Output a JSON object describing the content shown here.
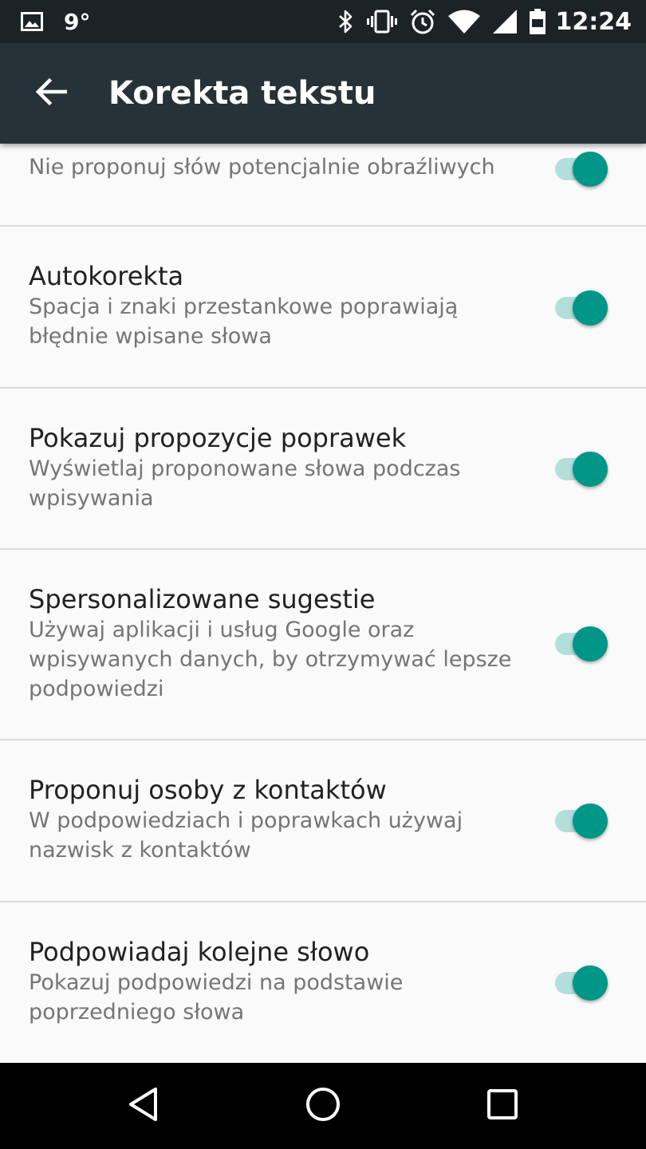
{
  "status_bar": {
    "temperature": "9°",
    "time": "12:24",
    "icons": [
      "image-icon",
      "bluetooth-icon",
      "vibrate-icon",
      "alarm-icon",
      "wifi-icon",
      "signal-icon",
      "battery-icon"
    ]
  },
  "app_bar": {
    "title": "Korekta tekstu",
    "back_icon": "arrow-back-icon"
  },
  "settings": [
    {
      "title": "",
      "subtitle": "Nie proponuj słów potencjalnie obraźliwych",
      "enabled": true
    },
    {
      "title": "Autokorekta",
      "subtitle": "Spacja i znaki przestankowe poprawiają błędnie wpisane słowa",
      "enabled": true
    },
    {
      "title": "Pokazuj propozycje poprawek",
      "subtitle": "Wyświetlaj proponowane słowa podczas wpisywania",
      "enabled": true
    },
    {
      "title": "Spersonalizowane sugestie",
      "subtitle": "Używaj aplikacji i usług Google oraz wpisywanych danych, by otrzymywać lepsze podpowiedzi",
      "enabled": true
    },
    {
      "title": "Proponuj osoby z kontaktów",
      "subtitle": "W podpowiedziach i poprawkach używaj nazwisk z kontaktów",
      "enabled": true
    },
    {
      "title": "Podpowiadaj kolejne słowo",
      "subtitle": "Pokazuj podpowiedzi na podstawie poprzedniego słowa",
      "enabled": true
    }
  ],
  "nav_bar": {
    "icons": [
      "back-triangle-icon",
      "home-circle-icon",
      "recents-square-icon"
    ]
  },
  "colors": {
    "status_bar": "#1c2327",
    "app_bar": "#263238",
    "switch_thumb": "#009688",
    "switch_track": "#b2dfdb",
    "background": "#fafafa"
  }
}
